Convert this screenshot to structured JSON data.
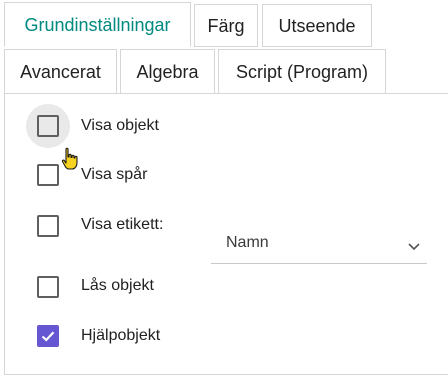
{
  "tabs": [
    {
      "label": "Grundinställningar",
      "active": true
    },
    {
      "label": "Färg",
      "active": false
    },
    {
      "label": "Utseende",
      "active": false
    },
    {
      "label": "Avancerat",
      "active": false
    },
    {
      "label": "Algebra",
      "active": false
    },
    {
      "label": "Script (Program)",
      "active": false
    }
  ],
  "options": {
    "show_object": {
      "label": "Visa objekt",
      "checked": false
    },
    "show_trace": {
      "label": "Visa spår",
      "checked": false
    },
    "show_label": {
      "label": "Visa etikett:",
      "checked": false
    },
    "lock_object": {
      "label": "Lås objekt",
      "checked": false
    },
    "auxiliary_object": {
      "label": "Hjälpobjekt",
      "checked": true
    }
  },
  "label_select": {
    "value": "Namn"
  },
  "colors": {
    "accent_tab": "#008a80",
    "checkbox_checked": "#6557d2",
    "border": "#d6d6d6"
  },
  "icons": {
    "cursor": "hand-pointer-icon",
    "dropdown": "chevron-down-icon",
    "checkmark": "check-icon"
  }
}
